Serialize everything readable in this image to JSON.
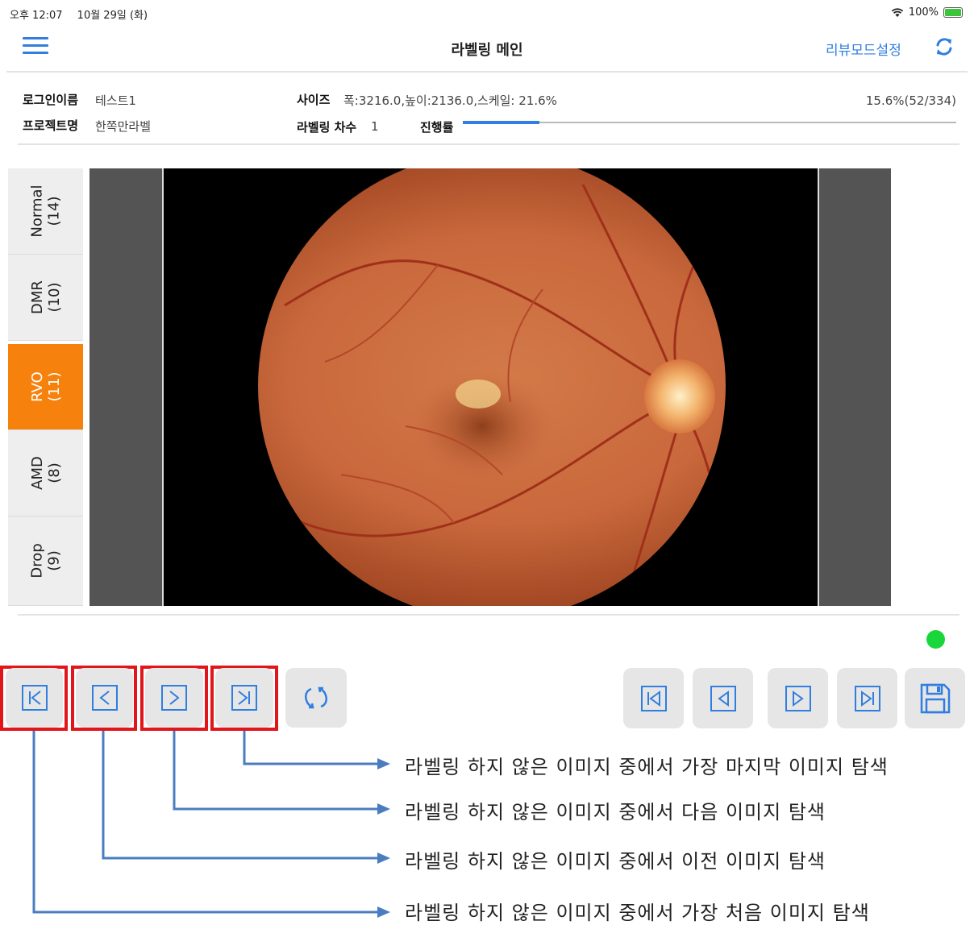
{
  "status_bar": {
    "time": "오후 12:07",
    "date": "10월 29일 (화)",
    "battery": "100%"
  },
  "nav": {
    "title": "라벨링 메인",
    "review_mode": "리뷰모드설정",
    "menu_icon": "hamburger-menu-icon",
    "refresh_icon": "refresh-icon",
    "accent_color": "#2f7ee0"
  },
  "info": {
    "login_label": "로그인이름",
    "login_value": "테스트1",
    "project_label": "프로젝트명",
    "project_value": "한쪽만라벨",
    "size_label": "사이즈",
    "size_value": "폭:3216.0,높이:2136.0,스케일: 21.6%",
    "round_label": "라벨링 차수",
    "round_value": "1",
    "progress_label": "진행률",
    "progress_text": "15.6%(52/334)",
    "progress_fraction": 0.156
  },
  "tabs": [
    {
      "name": "Normal",
      "count": "(14)",
      "active": false
    },
    {
      "name": "DMR",
      "count": "(10)",
      "active": false
    },
    {
      "name": "RVO",
      "count": "(11)",
      "active": true
    },
    {
      "name": "AMD",
      "count": "(8)",
      "active": false
    },
    {
      "name": "Drop",
      "count": "(9)",
      "active": false
    }
  ],
  "active_color": "#f6820d",
  "status_color": "#19d63b",
  "buttons_left": [
    {
      "icon": "first-unlabeled-icon"
    },
    {
      "icon": "prev-unlabeled-icon"
    },
    {
      "icon": "next-unlabeled-icon"
    },
    {
      "icon": "last-unlabeled-icon"
    },
    {
      "icon": "rotate-icon"
    }
  ],
  "buttons_right": [
    {
      "icon": "first-image-icon"
    },
    {
      "icon": "prev-image-icon"
    },
    {
      "icon": "next-image-icon"
    },
    {
      "icon": "last-image-icon"
    },
    {
      "icon": "save-icon"
    }
  ],
  "annotations": [
    "라벨링 하지 않은 이미지 중에서 가장 마지막 이미지 탐색",
    "라벨링 하지 않은 이미지 중에서 다음 이미지 탐색",
    "라벨링 하지 않은 이미지 중에서 이전 이미지 탐색",
    "라벨링 하지 않은 이미지 중에서 가장 처음 이미지 탐색"
  ]
}
